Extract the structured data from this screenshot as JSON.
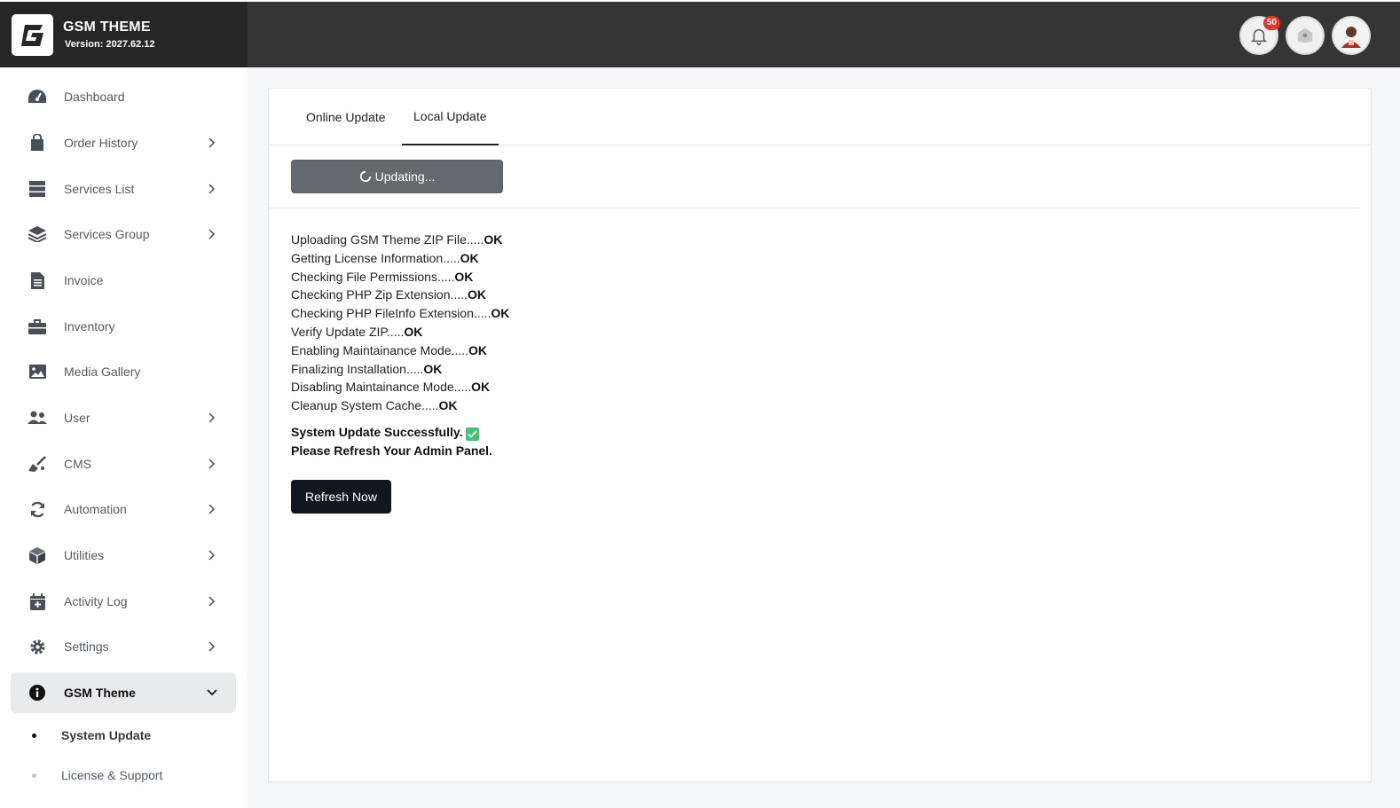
{
  "brand": {
    "title": "GSM THEME",
    "version": "Version: 2027.62.12",
    "logo_icon": "g-logo-icon"
  },
  "header": {
    "notification_count": "50",
    "icons": [
      "bell-icon",
      "home-icon",
      "user-avatar"
    ]
  },
  "sidebar": {
    "items": [
      {
        "label": "Dashboard",
        "icon": "dashboard-icon",
        "has_submenu": false
      },
      {
        "label": "Order History",
        "icon": "shopping-bag-icon",
        "has_submenu": true
      },
      {
        "label": "Services List",
        "icon": "server-list-icon",
        "has_submenu": true
      },
      {
        "label": "Services Group",
        "icon": "layers-icon",
        "has_submenu": true
      },
      {
        "label": "Invoice",
        "icon": "invoice-icon",
        "has_submenu": false
      },
      {
        "label": "Inventory",
        "icon": "briefcase-icon",
        "has_submenu": false
      },
      {
        "label": "Media Gallery",
        "icon": "image-icon",
        "has_submenu": false
      },
      {
        "label": "User",
        "icon": "users-icon",
        "has_submenu": true
      },
      {
        "label": "CMS",
        "icon": "broom-icon",
        "has_submenu": true
      },
      {
        "label": "Automation",
        "icon": "sync-icon",
        "has_submenu": true
      },
      {
        "label": "Utilities",
        "icon": "cube-icon",
        "has_submenu": true
      },
      {
        "label": "Activity Log",
        "icon": "calendar-plus-icon",
        "has_submenu": true
      },
      {
        "label": "Settings",
        "icon": "gear-icon",
        "has_submenu": true
      },
      {
        "label": "GSM Theme",
        "icon": "info-icon",
        "has_submenu": true,
        "expanded": true
      }
    ],
    "subitems": [
      {
        "label": "System Update",
        "active": true
      },
      {
        "label": "License & Support",
        "active": false
      }
    ]
  },
  "main": {
    "tabs": [
      {
        "label": "Online Update",
        "active": false
      },
      {
        "label": "Local Update",
        "active": true
      }
    ],
    "updating_label": "Updating...",
    "log": [
      {
        "text": "Uploading GSM Theme ZIP File.....",
        "status": "OK"
      },
      {
        "text": "Getting License Information.....",
        "status": "OK"
      },
      {
        "text": "Checking File Permissions.....",
        "status": "OK"
      },
      {
        "text": "Checking PHP Zip Extension.....",
        "status": "OK"
      },
      {
        "text": "Checking PHP FileInfo Extension.....",
        "status": "OK"
      },
      {
        "text": "Verify Update ZIP.....",
        "status": "OK"
      },
      {
        "text": "Enabling Maintainance Mode.....",
        "status": "OK"
      },
      {
        "text": "Finalizing Installation.....",
        "status": "OK"
      },
      {
        "text": "Disabling Maintainance Mode.....",
        "status": "OK"
      },
      {
        "text": "Cleanup System Cache.....",
        "status": "OK"
      }
    ],
    "success_line1": "System Update Successfully.",
    "success_line2": "Please Refresh Your Admin Panel.",
    "refresh_label": "Refresh Now"
  },
  "colors": {
    "header_dark": "#353535",
    "brand_dark": "#262626",
    "badge_red": "#e3342f",
    "button_dark": "#12161d",
    "button_gray": "#66696e",
    "check_green": "#46c277"
  }
}
